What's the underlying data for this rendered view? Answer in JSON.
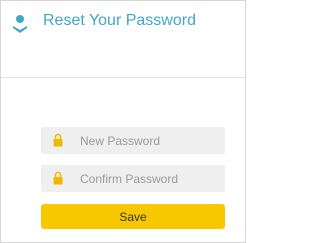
{
  "header": {
    "title": "Reset Your Password",
    "icon": "user-icon",
    "accent_color": "#3fa7c7"
  },
  "form": {
    "new_password": {
      "placeholder": "New Password",
      "icon": "lock-icon"
    },
    "confirm_password": {
      "placeholder": "Confirm Password",
      "icon": "lock-icon"
    },
    "save_label": "Save",
    "save_color": "#f7c800"
  }
}
